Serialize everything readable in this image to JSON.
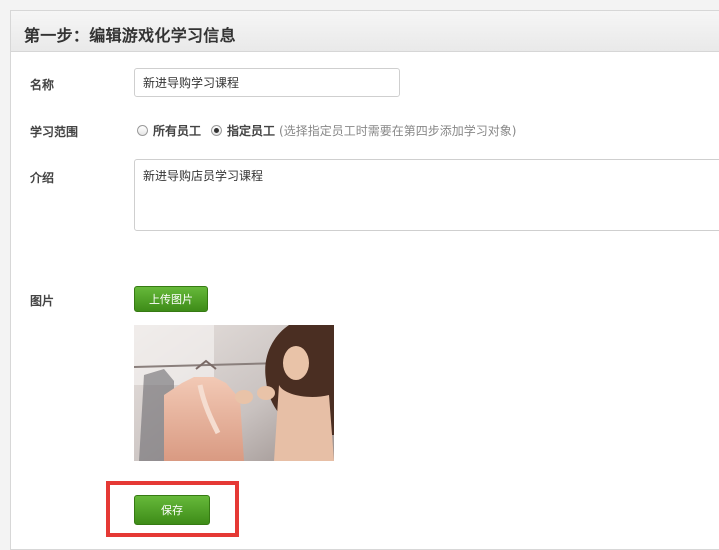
{
  "header": {
    "title": "第一步：编辑游戏化学习信息"
  },
  "form": {
    "name_label": "名称",
    "name_value": "新进导购学习课程",
    "scope_label": "学习范围",
    "scope_options": [
      {
        "label": "所有员工",
        "selected": false
      },
      {
        "label": "指定员工",
        "selected": true
      }
    ],
    "scope_note": "(选择指定员工时需要在第四步添加学习对象)",
    "intro_label": "介绍",
    "intro_value": "新进导购店员学习课程",
    "image_label": "图片",
    "upload_label": "上传图片",
    "save_label": "保存"
  },
  "colors": {
    "button_green": "#4fa52a",
    "highlight_red": "#e53935"
  }
}
